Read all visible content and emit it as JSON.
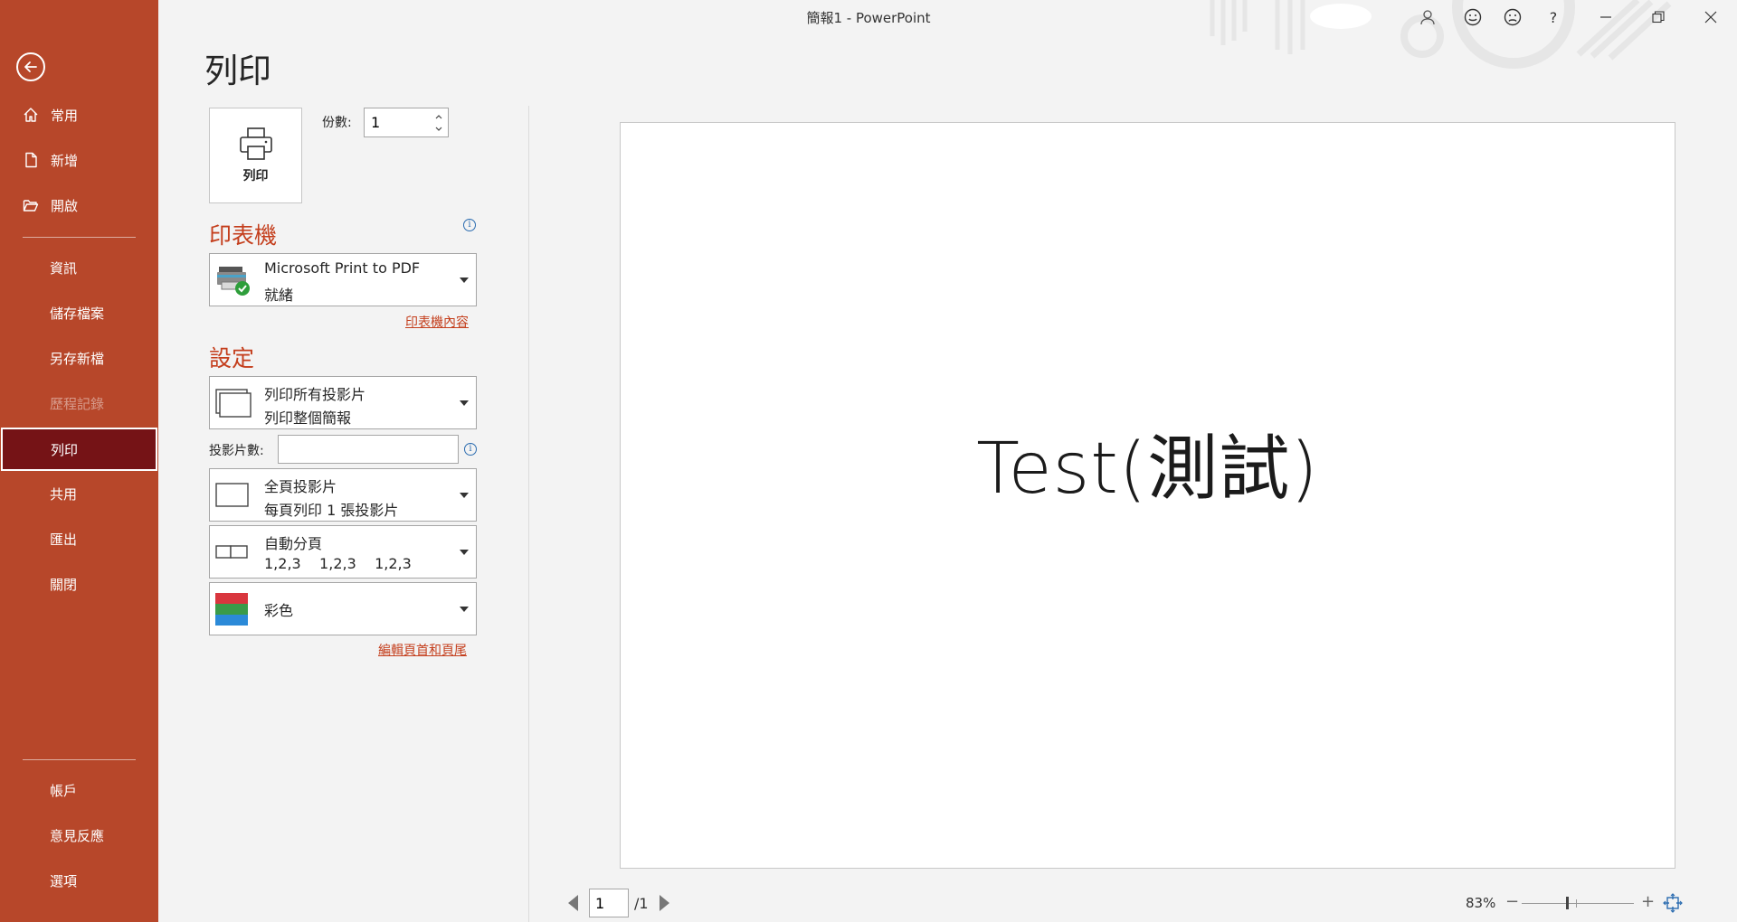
{
  "window": {
    "title": "簡報1  -  PowerPoint"
  },
  "titlebar": {
    "icons": [
      "account-icon",
      "smile-icon",
      "frown-icon",
      "help-icon",
      "minimize-icon",
      "restore-icon",
      "close-icon"
    ],
    "help_glyph": "?"
  },
  "nav": {
    "back_icon": "arrow-left-icon",
    "items": [
      {
        "label": "常用",
        "icon": "home-icon"
      },
      {
        "label": "新增",
        "icon": "new-doc-icon"
      },
      {
        "label": "開啟",
        "icon": "folder-open-icon"
      },
      {
        "label": "資訊"
      },
      {
        "label": "儲存檔案"
      },
      {
        "label": "另存新檔"
      },
      {
        "label": "歷程記錄",
        "disabled": true
      },
      {
        "label": "列印",
        "active": true
      },
      {
        "label": "共用"
      },
      {
        "label": "匯出"
      },
      {
        "label": "關閉"
      },
      {
        "label": "帳戶"
      },
      {
        "label": "意見反應"
      },
      {
        "label": "選項"
      }
    ]
  },
  "print": {
    "page_title": "列印",
    "print_button_label": "列印",
    "copies_label": "份數:",
    "copies_value": "1",
    "printer_heading": "印表機",
    "printer_name": "Microsoft Print to PDF",
    "printer_status": "就緒",
    "printer_properties_link": "印表機內容",
    "settings_heading": "設定",
    "slides_range": {
      "line1": "列印所有投影片",
      "line2": "列印整個簡報"
    },
    "slides_label": "投影片數:",
    "slides_value": "",
    "layout": {
      "line1": "全頁投影片",
      "line2": "每頁列印 1 張投影片"
    },
    "collation": {
      "line1": "自動分頁",
      "line2": "1,2,3    1,2,3    1,2,3"
    },
    "color": {
      "line1": "彩色"
    },
    "header_footer_link": "編輯頁首和頁尾"
  },
  "preview": {
    "slide_text": "Test(測試)",
    "page_current": "1",
    "page_total": "/1",
    "zoom_percent": "83%",
    "zoom_level": 0.83,
    "zoom_minus": "−",
    "zoom_plus": "+"
  },
  "colors": {
    "nav_bg": "#b7472a",
    "nav_active": "#751316",
    "accent_text": "#c43e1c"
  }
}
